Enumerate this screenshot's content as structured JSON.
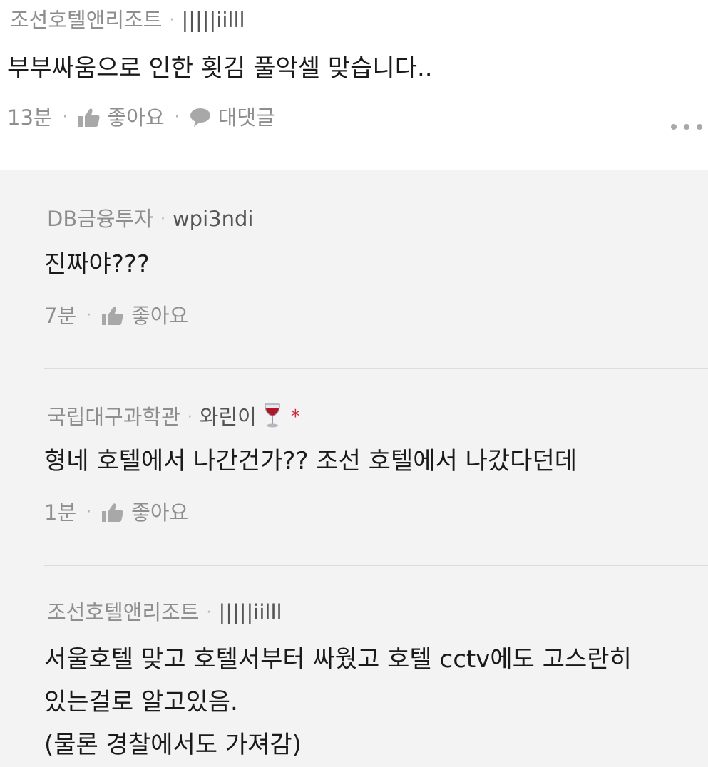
{
  "main_comment": {
    "org": "조선호텔앤리조트",
    "nick": "|||||iilll",
    "text": "부부싸움으로 인한 횟김 풀악셀 맞습니다..",
    "time": "13분",
    "like_label": "좋아요",
    "reply_label": "대댓글"
  },
  "replies": [
    {
      "org": "DB금융투자",
      "nick": "wpi3ndi",
      "text_lines": [
        "진짜야???"
      ],
      "time": "7분",
      "like_label": "좋아요"
    },
    {
      "org": "국립대구과학관",
      "nick": "와린이",
      "badge_icon": "wine-glass-icon",
      "star": "*",
      "text_lines": [
        "형네 호텔에서 나간건가?? 조선 호텔에서 나갔다던데"
      ],
      "time": "1분",
      "like_label": "좋아요"
    },
    {
      "org": "조선호텔앤리조트",
      "nick": "|||||iilll",
      "text_lines": [
        "서울호텔 맞고 호텔서부터 싸웠고 호텔 cctv에도 고스란히",
        "있는걸로 알고있음.",
        "(물론 경찰에서도 가져감)"
      ]
    }
  ],
  "colors": {
    "meta": "#8e8e8e",
    "nick": "#555555",
    "body": "#1a1a1a",
    "reply_bg": "#f3f3f3",
    "star": "#d0243a"
  }
}
